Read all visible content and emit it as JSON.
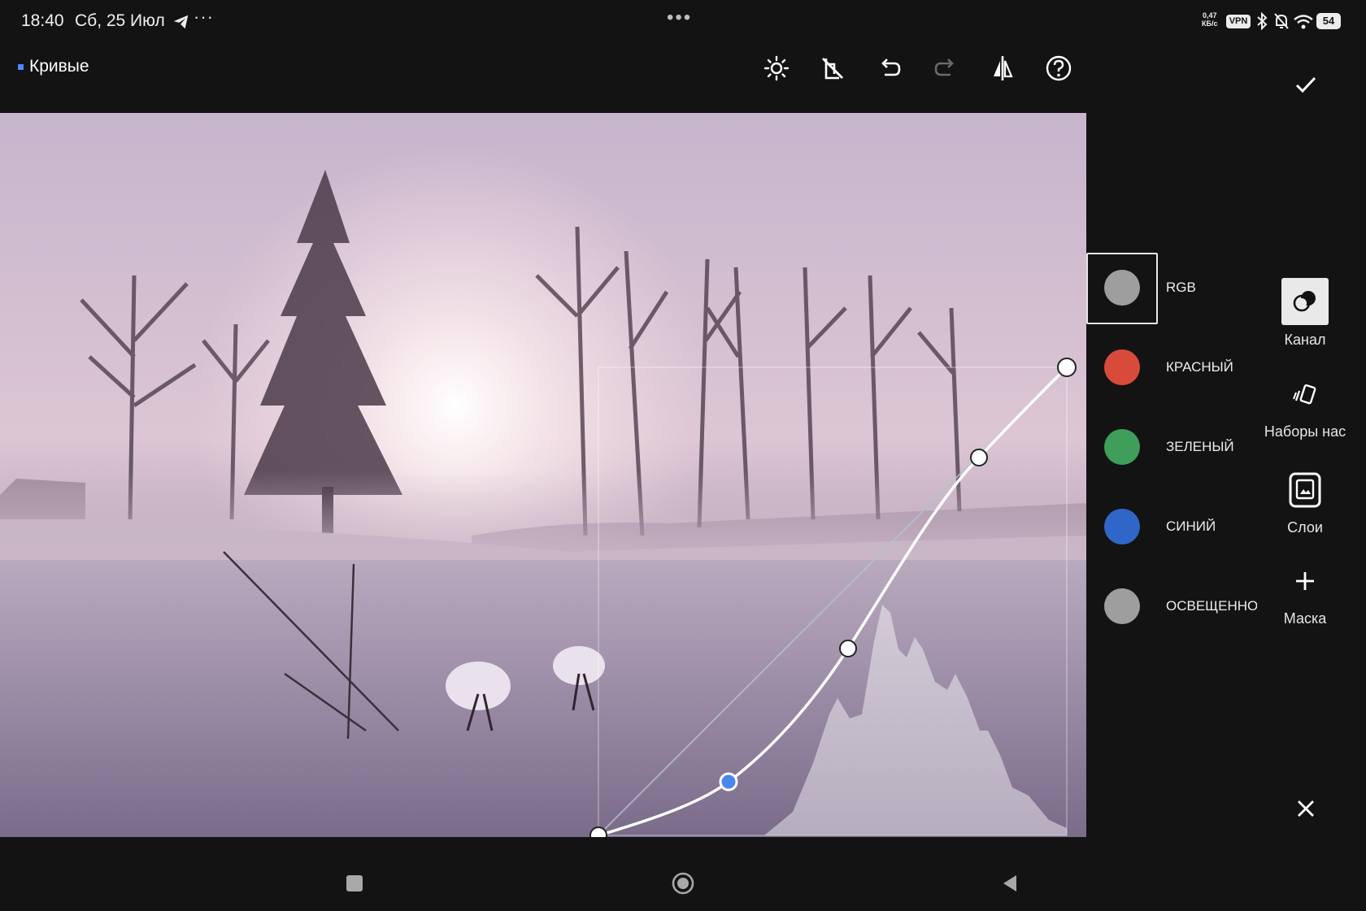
{
  "status": {
    "time": "18:40",
    "date": "Сб, 25 Июл",
    "more": "···",
    "center_dots": "•••",
    "speed_value": "0,47",
    "speed_unit": "КБ/с",
    "vpn": "VPN",
    "battery": "54"
  },
  "header": {
    "title": "Кривые",
    "accent_color": "#4a8cff"
  },
  "toolbar": {
    "icons": [
      "brightness-icon",
      "auto-off-icon",
      "undo-icon",
      "redo-icon",
      "compare-icon",
      "help-icon"
    ]
  },
  "channels": [
    {
      "label": "RGB",
      "color": "#9e9e9e",
      "selected": true
    },
    {
      "label": "КРАСНЫЙ",
      "color": "#d84b3b"
    },
    {
      "label": "ЗЕЛЕНЫЙ",
      "color": "#3f9e5a"
    },
    {
      "label": "СИНИЙ",
      "color": "#2f66c8"
    },
    {
      "label": "ОСВЕЩЕННОСТЬ",
      "color": "#9e9e9e"
    }
  ],
  "tools": {
    "channel": "Канал",
    "presets": "Наборы нас",
    "layers": "Слои",
    "mask": "Маска"
  }
}
